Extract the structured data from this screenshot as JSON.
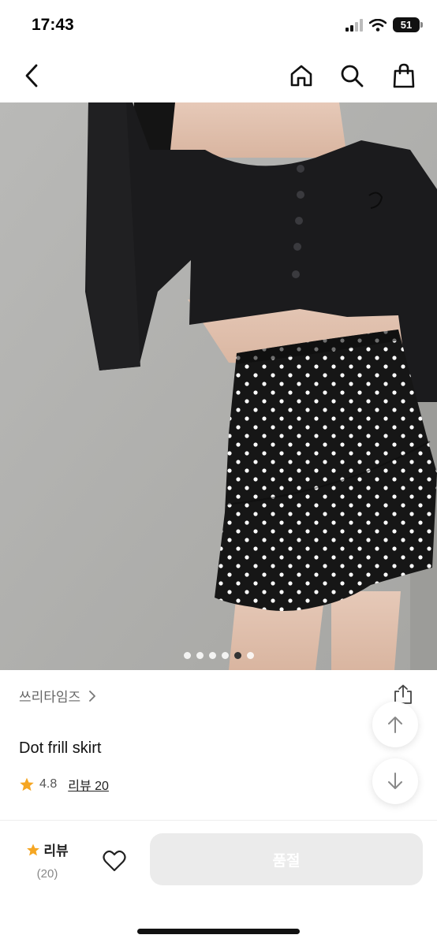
{
  "status_bar": {
    "time": "17:43",
    "battery": "51",
    "icons": [
      "signal-icon",
      "wifi-icon",
      "battery-icon"
    ]
  },
  "nav": {
    "icons": [
      "back-icon",
      "home-icon",
      "search-icon",
      "shopping-bag-icon"
    ]
  },
  "carousel": {
    "total": 6,
    "active_index": 4
  },
  "product": {
    "brand": "쓰리타임즈",
    "name": "Dot frill skirt",
    "rating": "4.8",
    "review_link": "리뷰 20"
  },
  "floating": {
    "icons": [
      "share-icon",
      "arrow-up-icon",
      "arrow-down-icon"
    ]
  },
  "bottom_bar": {
    "review_label": "리뷰",
    "review_count": "(20)",
    "soldout_label": "품절"
  },
  "colors": {
    "star": "#f5a623",
    "soldout_bg": "#ebebeb",
    "dot_active": "#333333"
  }
}
